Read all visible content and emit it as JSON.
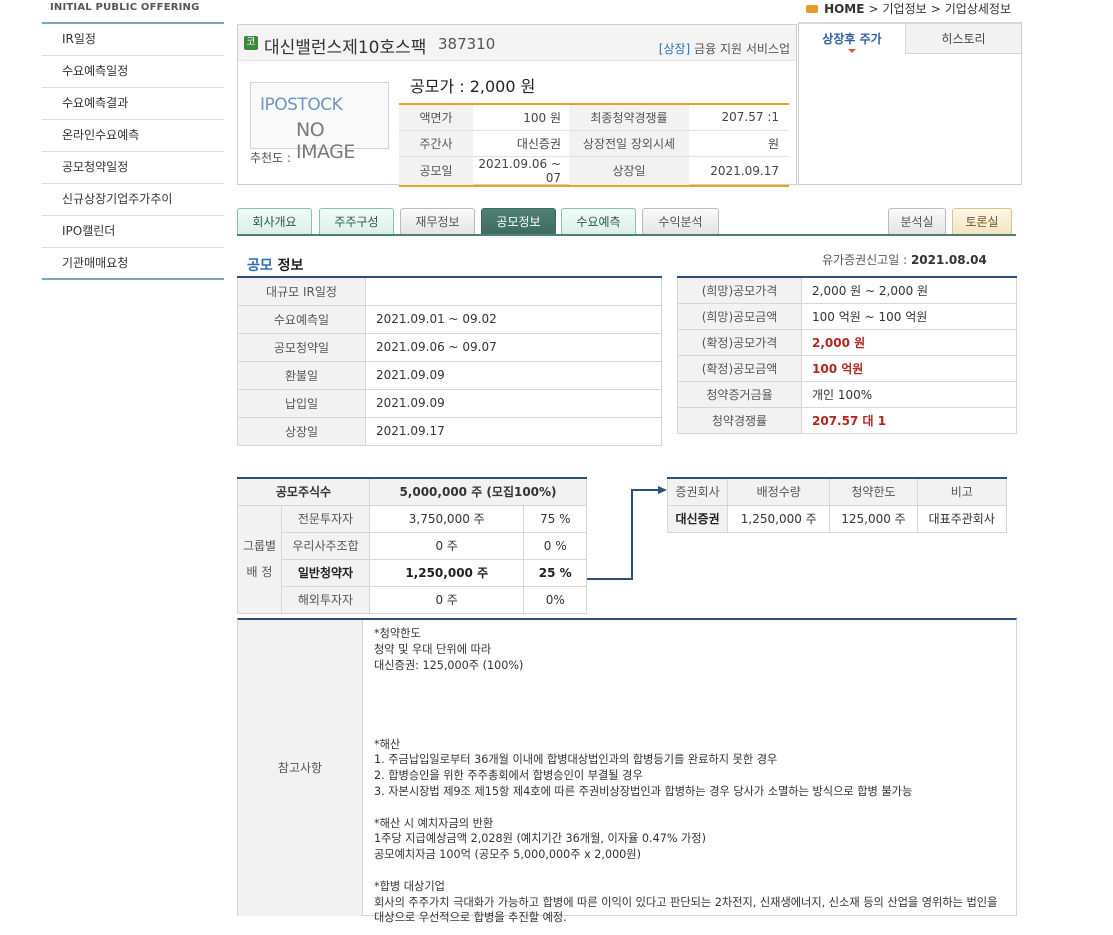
{
  "sidebar": {
    "header": "INITIAL PUBLIC OFFERING",
    "items": [
      {
        "label": "IR일정"
      },
      {
        "label": "수요예측일정"
      },
      {
        "label": "수요예측결과"
      },
      {
        "label": "온라인수요예측"
      },
      {
        "label": "공모청약일정"
      },
      {
        "label": "신규상장기업주가추이"
      },
      {
        "label": "IPO캘린더"
      },
      {
        "label": "기관매매요청"
      }
    ]
  },
  "breadcrumb": {
    "home": "HOME",
    "crumb1": "기업정보",
    "crumb2": "기업상세정보",
    "sep": ">"
  },
  "company": {
    "market_badge": "코",
    "name": "대신밸런스제10호스팩",
    "code": "387310",
    "status": "[상장]",
    "industry": "금융 지원 서비스업",
    "noimage_line1": "IPOSTOCK",
    "noimage_line2": "NO IMAGE",
    "recommend_label": "추천도 :",
    "offer_price_label": "공모가 :",
    "offer_price_value": "2,000 원",
    "rows": [
      {
        "k1": "액면가",
        "v1": "100 원",
        "k2": "최종청약경쟁률",
        "v2": "207.57 :1"
      },
      {
        "k1": "주간사",
        "v1": "대신증권",
        "k2": "상장전일 장외시세",
        "v2": "원"
      },
      {
        "k1": "공모일",
        "v1": "2021.09.06 ~ 07",
        "k2": "상장일",
        "v2": "2021.09.17"
      }
    ]
  },
  "price_panel": {
    "tab1": "상장후 주가",
    "tab2": "히스토리"
  },
  "nav_tabs": {
    "t1": "회사개요",
    "t2": "주주구성",
    "t3": "재무정보",
    "t4": "공모정보",
    "t5": "수요예측",
    "t6": "수익분석",
    "t7": "분석실",
    "t8": "토론실"
  },
  "section": {
    "title_highlight": "공모",
    "title_rest": " 정보",
    "filing_label": "유가증권신고일 : ",
    "filing_date": "2021.08.04"
  },
  "schedule": [
    {
      "k": "대규모 IR일정",
      "v": ""
    },
    {
      "k": "수요예측일",
      "v": "2021.09.01 ~ 09.02"
    },
    {
      "k": "공모청약일",
      "v": "2021.09.06 ~ 09.07"
    },
    {
      "k": "환불일",
      "v": "2021.09.09"
    },
    {
      "k": "납입일",
      "v": "2021.09.09"
    },
    {
      "k": "상장일",
      "v": "2021.09.17"
    }
  ],
  "price_info": [
    {
      "k": "(희망)공모가격",
      "v": "2,000 원 ~ 2,000 원"
    },
    {
      "k": "(희망)공모금액",
      "v": "100 억원  ~ 100 억원"
    },
    {
      "k": "(확정)공모가격",
      "v": "2,000 원"
    },
    {
      "k": "(확정)공모금액",
      "v": "100 억원"
    },
    {
      "k": "청약증거금율",
      "v": "개인 100%"
    },
    {
      "k": "청약경쟁률",
      "v": "207.57 대 1"
    }
  ],
  "allocation": {
    "total_label": "공모주식수",
    "total_value": "5,000,000 주 (모집100%)",
    "group_label_1": "그룹별",
    "group_label_2": "배 정",
    "rows": [
      {
        "k": "전문투자자",
        "shares": "3,750,000 주",
        "pct": "75 %"
      },
      {
        "k": "우리사주조합",
        "shares": "0 주",
        "pct": "0 %"
      },
      {
        "k": "일반청약자",
        "shares": "1,250,000 주",
        "pct": "25 %"
      },
      {
        "k": "해외투자자",
        "shares": "0 주",
        "pct": "0%"
      }
    ]
  },
  "broker": {
    "headers": [
      "증권회사",
      "배정수량",
      "청약한도",
      "비고"
    ],
    "row": {
      "name": "대신증권",
      "qty": "1,250,000 주",
      "limit": "125,000 주",
      "note": "대표주관회사"
    }
  },
  "notes": {
    "label": "참고사항",
    "body": "*청약한도\n청약 및 우대 단위에 따라\n대신증권: 125,000주 (100%)\n\n\n\n\n*해산\n1. 주금납입일로부터 36개월 이내에 합병대상법인과의 합병등기를 완료하지 못한 경우\n2. 합병승인을 위한 주주총회에서 합병승인이 부결될 경우\n3. 자본시장법 제9조 제15항 제4호에 따른 주권비상장법인과 합병하는 경우 당사가 소멸하는 방식으로 합병 불가능\n\n*해산 시 예치자금의 반환\n1주당 지급예상금액 2,028원 (예치기간 36개월, 이자율 0.47% 가정)\n공모예치자금 100억 (공모주 5,000,000주 x 2,000원)\n\n*합병 대상기업\n회사의 주주가치 극대화가 가능하고 합병에 따른 이익이 있다고 판단되는 2차전지, 신재생에너지, 신소재 등의 산업을 영위하는 법인을 대상으로 우선적으로 합병을 추진할 예정."
  },
  "colors": {
    "accent_blue": "#2c4f80",
    "price_red": "#b3261e",
    "tab_green": "#4f7f75",
    "orange": "#e8a22c"
  }
}
